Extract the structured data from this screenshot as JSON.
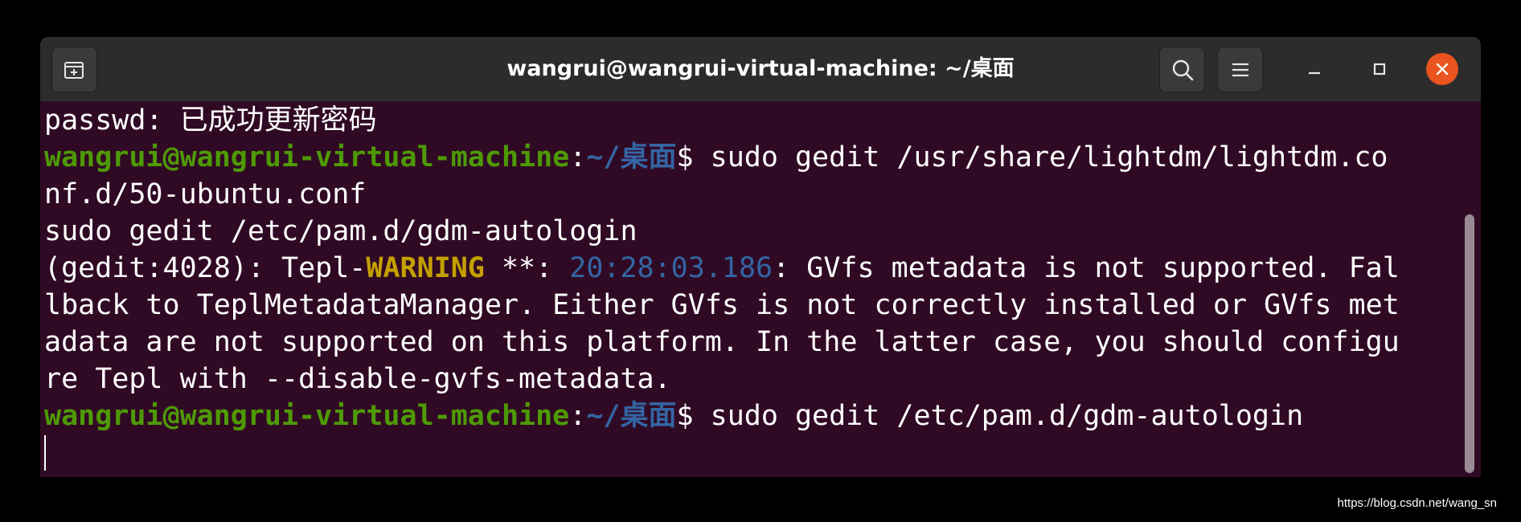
{
  "window": {
    "title": "wangrui@wangrui-virtual-machine: ~/桌面"
  },
  "colors": {
    "terminal_bg": "#300a24",
    "titlebar_bg": "#2c2c2c",
    "prompt_user": "#4e9a06",
    "prompt_path": "#3465a4",
    "warning": "#c4a000",
    "timestamp": "#3465a4",
    "close_button": "#e95420"
  },
  "icons": {
    "new_tab": "new-tab-icon",
    "search": "search-icon",
    "menu": "hamburger-menu-icon",
    "minimize": "minimize-icon",
    "maximize": "maximize-icon",
    "close": "close-icon"
  },
  "terminal": {
    "line1": "passwd: 已成功更新密码",
    "prompt1": {
      "user_host": "wangrui@wangrui-virtual-machine",
      "sep": ":",
      "path": "~/桌面",
      "symbol": "$ ",
      "command_part1": "sudo gedit /usr/share/lightdm/lightdm.co",
      "command_part2": "nf.d/50-ubuntu.conf"
    },
    "line4": "sudo gedit /etc/pam.d/gdm-autologin",
    "warning": {
      "prefix": "(gedit:4028): Tepl-",
      "level": "WARNING",
      "mid": " **: ",
      "timestamp": "20:28:03.186",
      "message1": ": GVfs metadata is not supported. Fal",
      "message2": "lback to TeplMetadataManager. Either GVfs is not correctly installed or GVfs met",
      "message3": "adata are not supported on this platform. In the latter case, you should configu",
      "message4": "re Tepl with --disable-gvfs-metadata."
    },
    "prompt2": {
      "user_host": "wangrui@wangrui-virtual-machine",
      "sep": ":",
      "path": "~/桌面",
      "symbol": "$ ",
      "command": "sudo gedit /etc/pam.d/gdm-autologin"
    }
  },
  "watermark": "https://blog.csdn.net/wang_sn"
}
